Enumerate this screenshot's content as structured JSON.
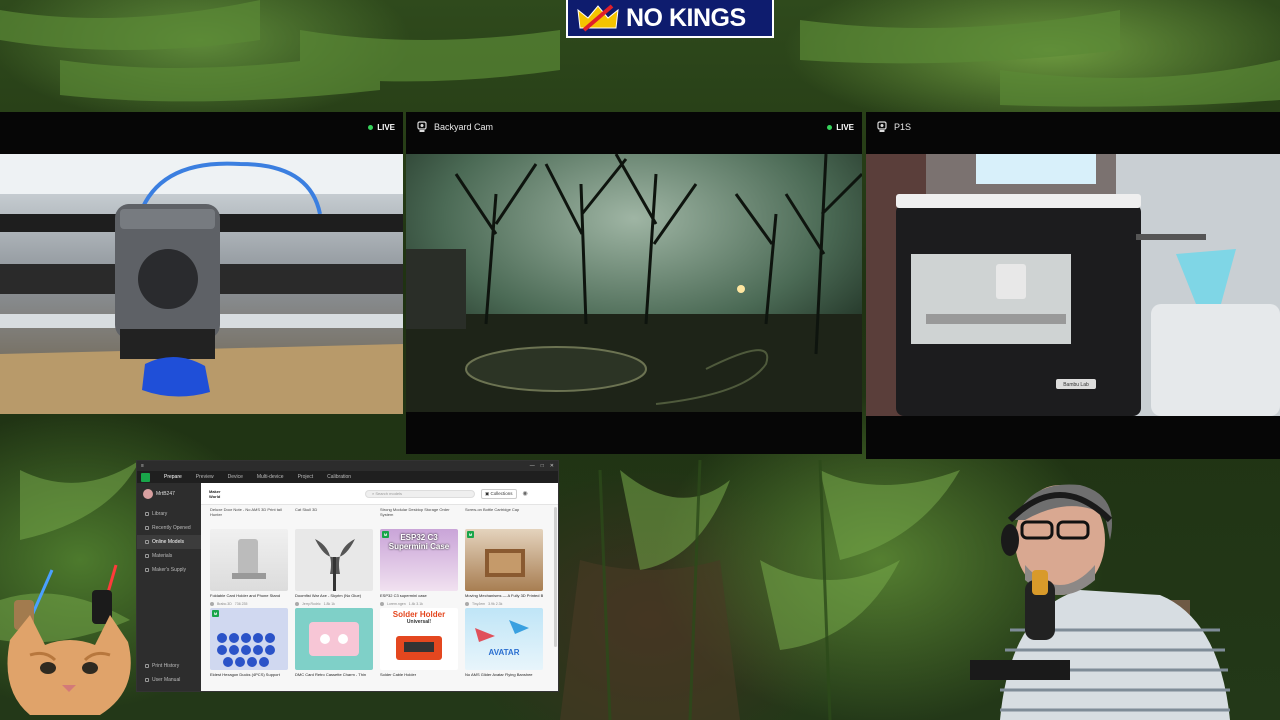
{
  "logo": {
    "text": "NO KINGS"
  },
  "cams": [
    {
      "title": "",
      "status": "LIVE"
    },
    {
      "title": "Backyard Cam",
      "status": "LIVE"
    },
    {
      "title": "P1S",
      "status": ""
    }
  ],
  "cam_overlays": {
    "printer_label": "Bambu Lab"
  },
  "app": {
    "window_title": "",
    "tabs": [
      "Prepare",
      "Preview",
      "Device",
      "Multi-device",
      "Project",
      "Calibration"
    ],
    "active_tab": "Prepare",
    "user": "MrtB247",
    "sidebar": [
      "Library",
      "Recently Opened",
      "Online Models",
      "Materials",
      "Maker's Supply"
    ],
    "sidebar_active": "Online Models",
    "sidebar_bottom": [
      "Print History",
      "User Manual"
    ],
    "brand": "Maker World",
    "search_placeholder": "Search models",
    "collections_label": "Collections",
    "prev_row": [
      "Deluxe Door Note - No AMS 3D Print tail Hunter",
      "Cat Skull 3D",
      "Strong Modular Desktop Storage Order System",
      "Screw-on Bottle Cartridge Cap"
    ],
    "cards": [
      {
        "name": "Foldable Card Holder and Phone Stand",
        "author": "Brabo.3D",
        "stats": "736  235"
      },
      {
        "name": "Doomfist War Axe - Skyrim (No Glue)",
        "author": "Jerry.Rodric",
        "stats": "1.8k  1k"
      },
      {
        "name": "ESP32 C3 supermini case",
        "author": "Lorem.ngen",
        "stats": "1.4k  3.1k",
        "overlay": "ESP32 C3 Supermini Case"
      },
      {
        "name": "Moving Mechanisms — A Fully 3D Printed Book",
        "author": "TinyJem",
        "stats": "3.9k  2.3k"
      },
      {
        "name": "Eldest Hexagon Ducks (4PCS) Support",
        "author": "",
        "stats": ""
      },
      {
        "name": "DMC Card Retro Cassette Charm - Thin",
        "author": "",
        "stats": ""
      },
      {
        "name": "Solder Cable Holder",
        "author": "",
        "stats": "",
        "overlay": "Solder Holder",
        "overlay2": "Universal!"
      },
      {
        "name": "No AMS Glider Avatar Flying Banshee",
        "author": "",
        "stats": "",
        "overlay": "AVATAR"
      }
    ]
  },
  "colors": {
    "logo_bg": "#0e1c6e",
    "live_dot": "#36d35b",
    "bambu_green": "#19a54a",
    "filament_blue": "#1f4fd8"
  }
}
